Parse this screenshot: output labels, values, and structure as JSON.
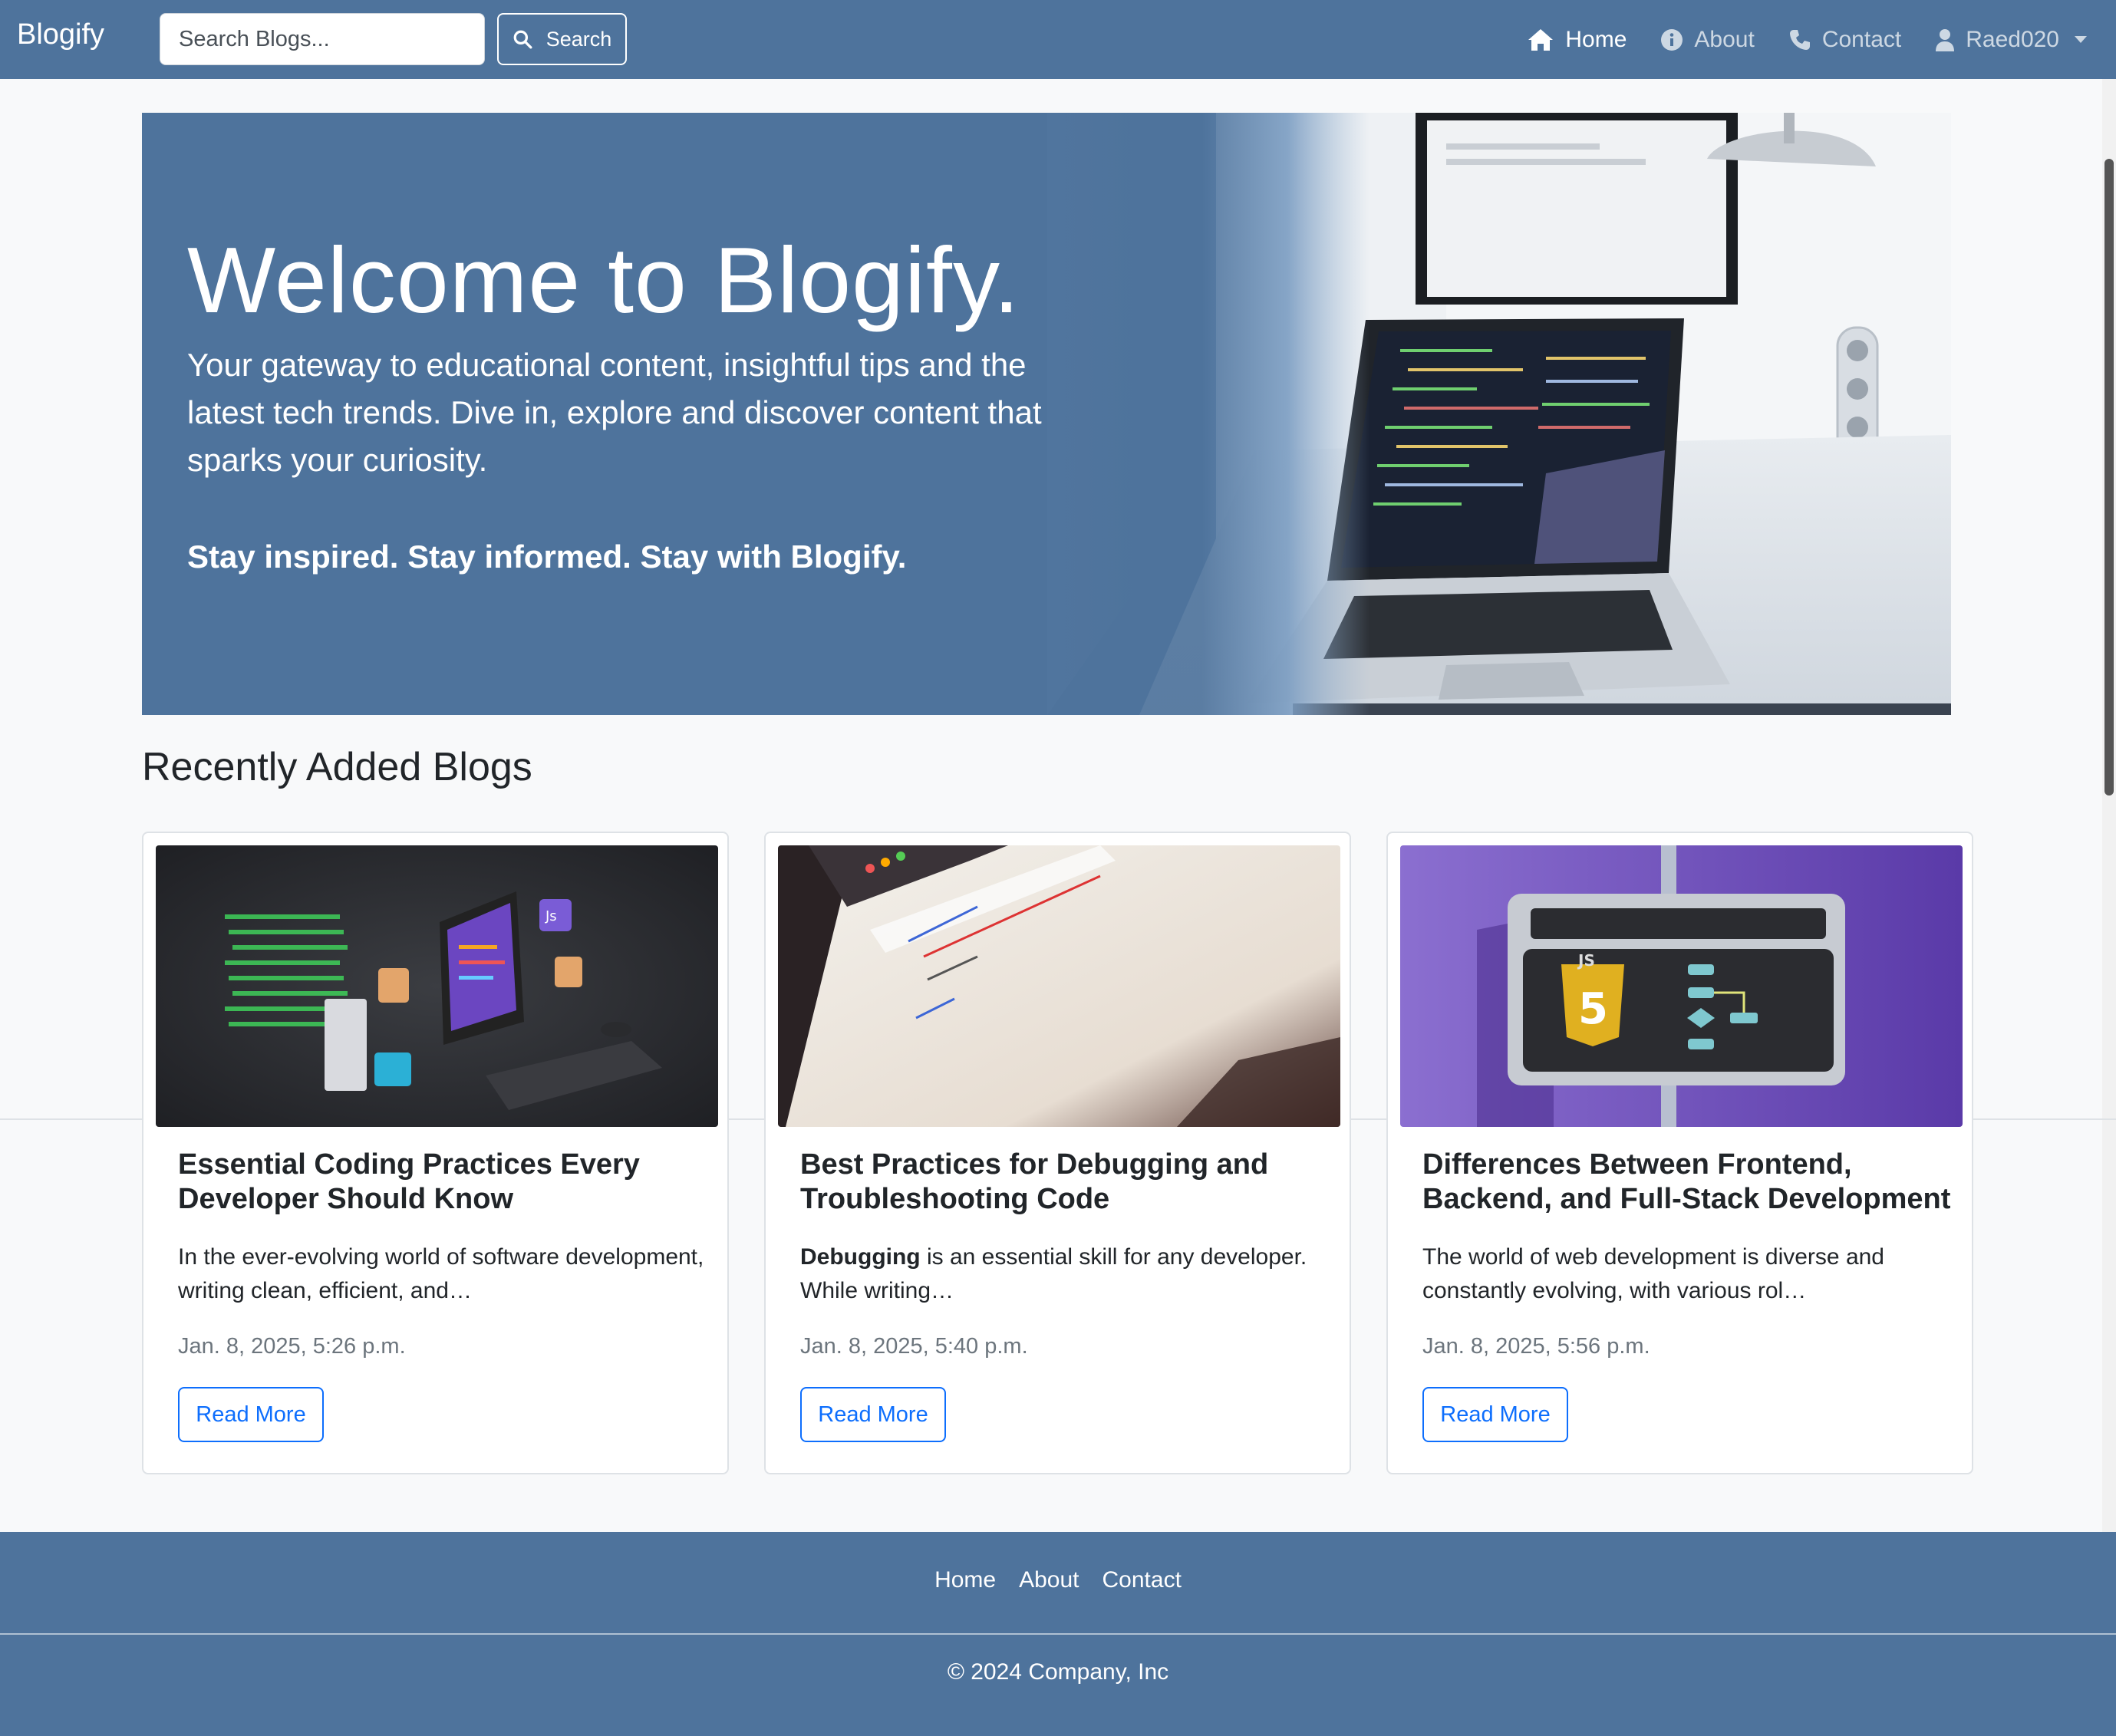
{
  "navbar": {
    "brand": "Blogify",
    "search_placeholder": "Search Blogs...",
    "search_button": "Search",
    "items": [
      {
        "label": "Home",
        "icon": "home-icon",
        "active": true
      },
      {
        "label": "About",
        "icon": "info-icon",
        "active": false
      },
      {
        "label": "Contact",
        "icon": "phone-icon",
        "active": false
      }
    ],
    "user": {
      "label": "Raed020",
      "icon": "user-icon"
    }
  },
  "hero": {
    "title": "Welcome to Blogify.",
    "subtitle": "Your gateway to educational content, insightful tips and the latest tech trends. Dive in, explore and discover content that sparks your curiosity.",
    "tagline": "Stay inspired. Stay informed. Stay with Blogify."
  },
  "section": {
    "title": "Recently Added Blogs"
  },
  "posts": [
    {
      "title": "Essential Coding Practices Every Developer Should Know",
      "excerpt": "In the ever-evolving world of software development, writing clean, efficient, and…",
      "date": "Jan. 8, 2025, 5:26 p.m.",
      "button": "Read More"
    },
    {
      "title": "Best Practices for Debugging and Troubleshooting Code",
      "excerpt_bold": "Debugging",
      "excerpt": " is an essential skill for any developer. While writing…",
      "date": "Jan. 8, 2025, 5:40 p.m.",
      "button": "Read More"
    },
    {
      "title": "Differences Between Frontend, Backend, and Full-Stack Development",
      "excerpt": "The world of web development is diverse and constantly evolving, with various rol…",
      "date": "Jan. 8, 2025, 5:56 p.m.",
      "button": "Read More"
    }
  ],
  "footer": {
    "links": [
      "Home",
      "About",
      "Contact"
    ],
    "copyright": "© 2024 Company, Inc"
  },
  "colors": {
    "primary": "#4e739c",
    "link_blue": "#0d6efd",
    "muted": "#6c757d",
    "background": "#f8f9fa"
  }
}
